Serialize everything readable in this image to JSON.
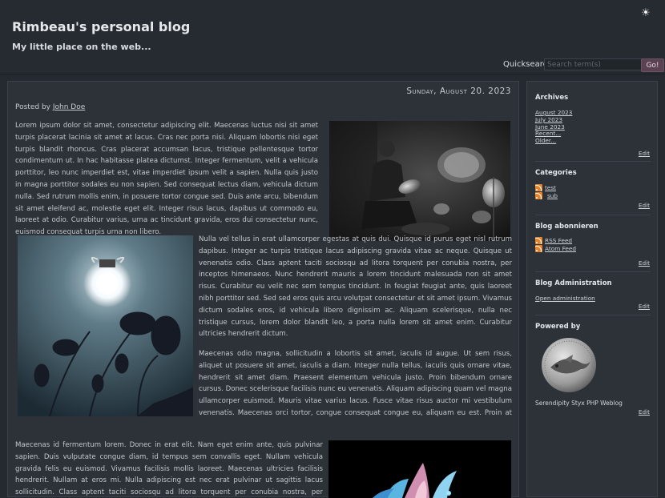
{
  "header": {
    "title": "Rimbeau's personal blog",
    "subtitle": "My little place on the web...",
    "theme_icon": "sun-icon",
    "quicksearch_label": "Quicksearch",
    "quicksearch_placeholder": "Search term(s)",
    "quicksearch_button": "Go!"
  },
  "post": {
    "date": "Sunday, August 20. 2023",
    "posted_by_prefix": "Posted by",
    "author": "John Doe",
    "para1": "Lorem ipsum dolor sit amet, consectetur adipiscing elit. Maecenas luctus nisi sit amet turpis placerat lacinia sit amet at lacus. Cras nec porta nisi. Aliquam lobortis nisi eget turpis blandit rhoncus. Cras placerat accumsan lacus, tristique pellentesque tortor condimentum ut. In hac habitasse platea dictumst. Integer fermentum, velit a vehicula porttitor, leo nunc imperdiet est, vitae imperdiet ipsum velit a sapien. Nulla quis justo in magna porttitor sodales eu non sapien. Sed consequat lectus diam, vehicula dictum nulla. Sed rutrum mollis enim, in posuere tortor congue sed. Duis ante arcu, bibendum sit amet eleifend ac, molestie eget elit. Integer risus lacus, dapibus ut commodo eu, laoreet at odio. Curabitur varius, urna ac tincidunt gravida, eros dui consectetur nunc, euismod consequat turpis urna non libero.",
    "para2": "Nulla vel tellus in erat ullamcorper egestas at quis dui. Quisque id purus eget nisl rutrum dapibus. Integer ac turpis tristique lacus adipiscing gravida vitae ac neque. Quisque ut venenatis odio. Class aptent taciti sociosqu ad litora torquent per conubia nostra, per inceptos himenaeos. Nunc hendrerit mauris a lorem tincidunt malesuada non sit amet risus. Curabitur eu velit nec sem tempus tincidunt. In feugiat feugiat ante, quis laoreet nibh porttitor sed. Sed sed eros quis arcu volutpat consectetur et sit amet ipsum. Vivamus dictum sodales eros, id vehicula libero dignissim ac. Aliquam scelerisque, nulla nec tristique cursus, lorem dolor blandit leo, a porta nulla lorem sit amet enim. Curabitur ultricies hendrerit dictum.",
    "para3": "Maecenas odio magna, sollicitudin a lobortis sit amet, iaculis id augue. Ut sem risus, aliquet ut posuere sit amet, iaculis a diam. Integer nulla tellus, iaculis quis ornare vitae, hendrerit sit amet diam. Praesent elementum vehicula justo. Proin bibendum ornare cursus. Donec scelerisque facilisis nunc eu venenatis. Aliquam adipiscing quam vel magna ullamcorper euismod. Mauris vitae varius lacus. Fusce vitae risus auctor mi vestibulum venenatis. Maecenas orci tortor, congue consequat congue eu, aliquam eu est. Proin at pretium purus. Phasellus nec turpis et elit ultrices elementum eu sit amet ipsum. In lobortis placerat aliquam. Proin fringilla urna placerat arcu iaculis dignissim at eget augue.",
    "para4": "Maecenas id fermentum lorem. Donec in erat elit. Nam eget enim ante, quis pulvinar sapien. Duis vulputate congue diam, id tempus sem convallis eget. Nullam vehicula gravida felis eu euismod. Vivamus facilisis mollis laoreet. Maecenas ultricies facilisis hendrerit. Nullam at eros mi. Nulla adipiscing est nec erat pulvinar ut sagittis lacus sollicitudin. Class aptent taciti sociosqu ad litora torquent per conubia nostra, per inceptos himenaeos. In laoreet molestie erat."
  },
  "sidebar": {
    "archives": {
      "title": "Archives",
      "links": [
        "August 2023",
        "July 2023",
        "June 2023",
        "Recent...",
        "Older..."
      ],
      "edit": "Edit"
    },
    "categories": {
      "title": "Categories",
      "items": [
        "test",
        "sub"
      ],
      "edit": "Edit"
    },
    "subscribe": {
      "title": "Blog abonnieren",
      "items": [
        "RSS Feed",
        "Atom Feed"
      ],
      "edit": "Edit"
    },
    "admin": {
      "title": "Blog Administration",
      "link": "Open administration",
      "edit": "Edit"
    },
    "powered": {
      "title": "Powered by",
      "text": "Serendipity Styx PHP Weblog",
      "edit": "Edit"
    }
  }
}
